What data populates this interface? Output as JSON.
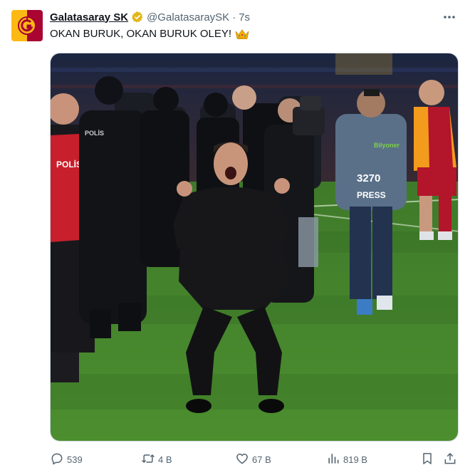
{
  "account": {
    "display_name": "Galatasaray SK",
    "handle": "@GalatasaraySK",
    "separator": "·",
    "time": "7s",
    "verified_badge": "gold-verified-badge-icon",
    "avatar_colors": {
      "primary": "#a90432",
      "secondary": "#fdb913"
    }
  },
  "tweet": {
    "text": "OKAN BURUK, OKAN BURUK OLEY!",
    "emoji": "crown-icon"
  },
  "media": {
    "type": "photo",
    "shirt_texts": {
      "police_back": "POLİS",
      "vest_number": "3270",
      "vest_label": "PRESS",
      "vest_logo": "Bilyoner",
      "police_jacket": "POLİS"
    }
  },
  "actions": {
    "reply_count": "539",
    "retweet_count": "4 B",
    "like_count": "67 B",
    "view_count": "819 B"
  },
  "colors": {
    "text_primary": "#0f1419",
    "text_secondary": "#536471",
    "border": "#cfd9de",
    "gold": "#e2b719"
  }
}
